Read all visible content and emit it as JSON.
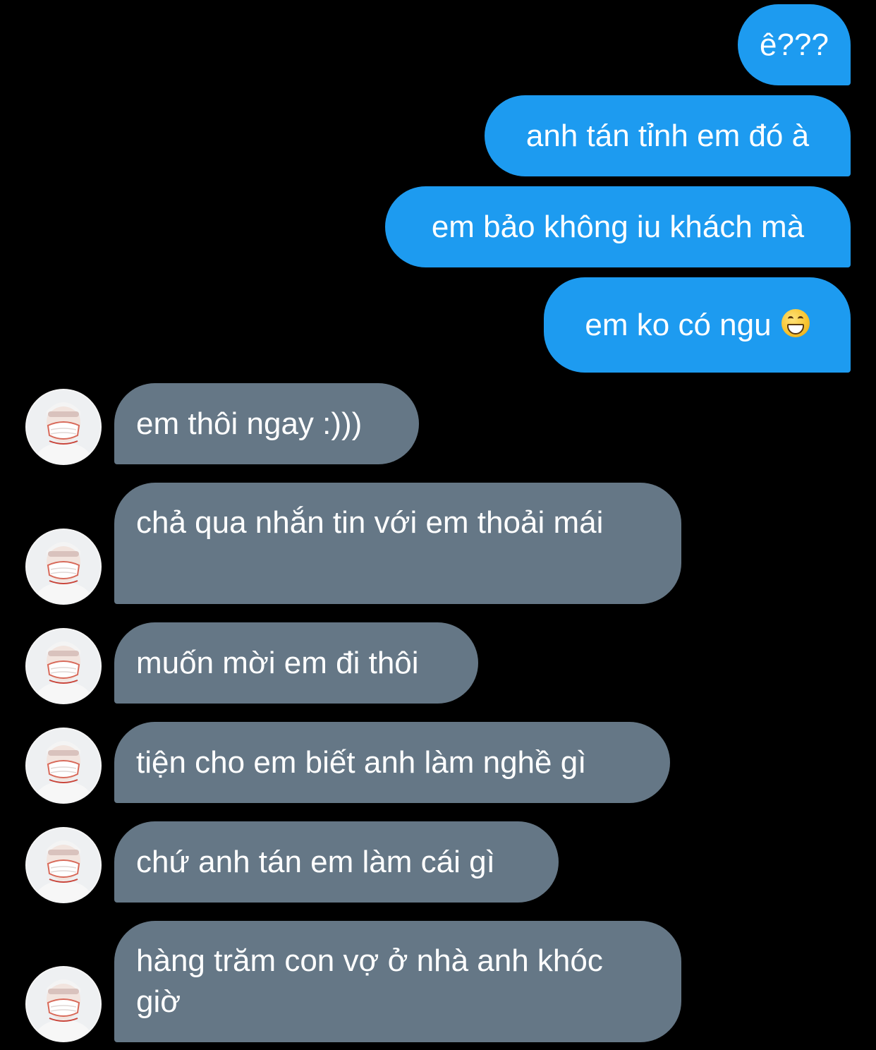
{
  "colors": {
    "background": "#000000",
    "sent_bubble": "#1d9bf0",
    "received_bubble": "#657786",
    "text": "#ffffff"
  },
  "messages": {
    "sent": [
      {
        "text": "ê???"
      },
      {
        "text": "anh tán tỉnh em đó à"
      },
      {
        "text": "em bảo không iu khách mà"
      },
      {
        "text": "em ko có ngu",
        "emoji": "grinning-face-emoji"
      }
    ],
    "received": [
      {
        "text": "em thôi ngay :)))"
      },
      {
        "text": "chả qua nhắn tin với em thoải mái"
      },
      {
        "text": "muốn mời em đi thôi"
      },
      {
        "text": "tiện cho em biết anh làm nghề gì"
      },
      {
        "text": "chứ anh tán em làm cái gì"
      },
      {
        "text": "hàng trăm con vợ ở nhà anh khóc giờ"
      }
    ]
  },
  "avatar": {
    "icon": "masked-person-avatar"
  }
}
